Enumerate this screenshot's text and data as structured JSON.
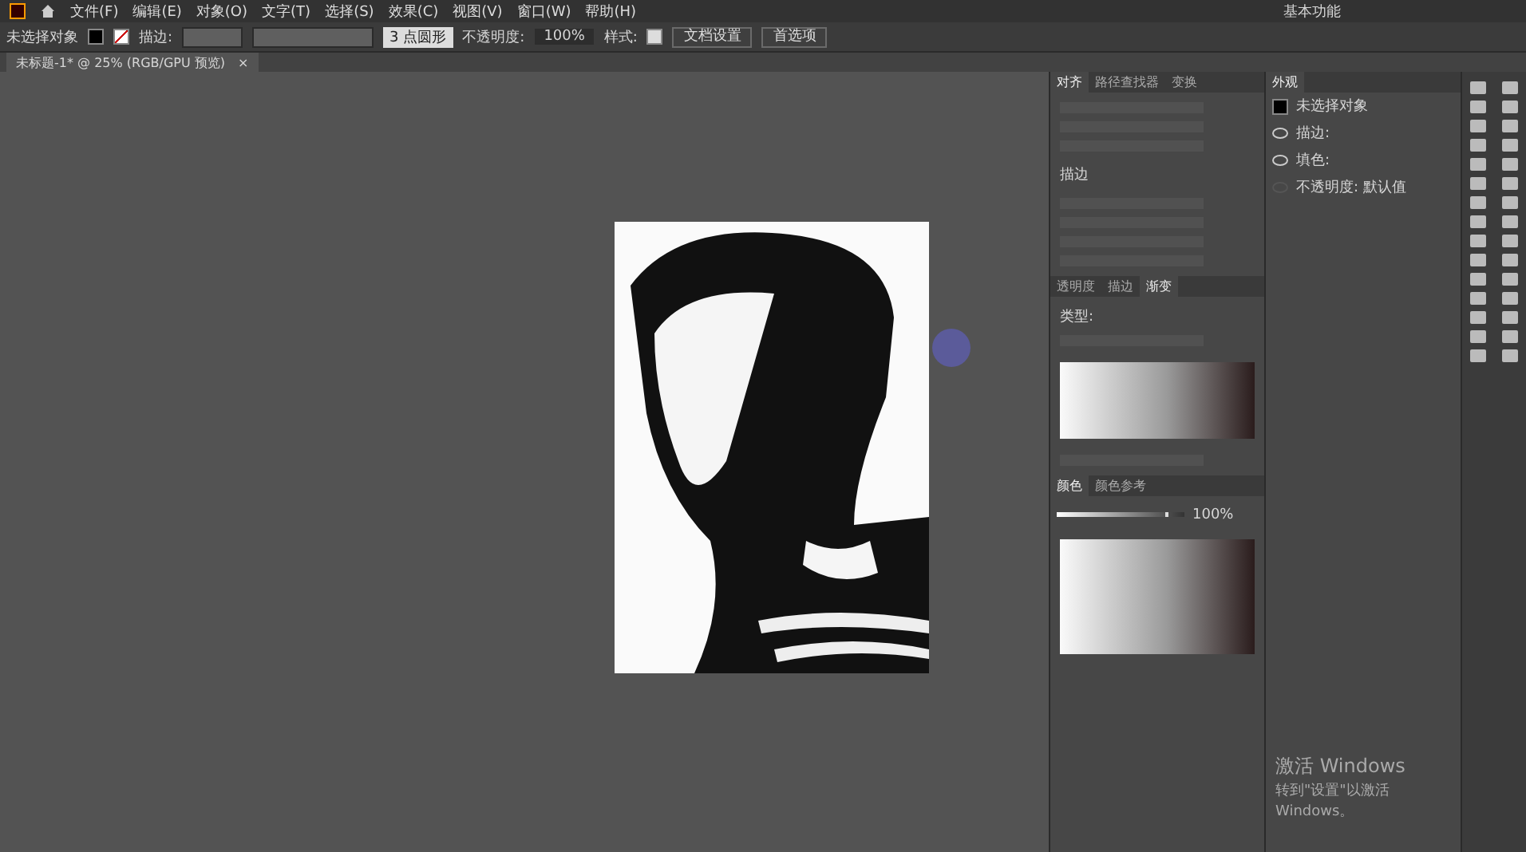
{
  "menu": {
    "items": [
      "文件(F)",
      "编辑(E)",
      "对象(O)",
      "文字(T)",
      "选择(S)",
      "效果(C)",
      "视图(V)",
      "窗口(W)",
      "帮助(H)"
    ],
    "workspace": "基本功能"
  },
  "control_bar": {
    "selection": "未选择对象",
    "stroke_label": "描边:",
    "brush": "3 点圆形",
    "opacity_label": "不透明度:",
    "opacity": "100%",
    "style_label": "样式:",
    "buttons": [
      "文档设置",
      "首选项"
    ]
  },
  "doc_tab": {
    "title": "未标题-1* @ 25% (RGB/GPU 预览)",
    "close": "×"
  },
  "align_panel": {
    "tabs": [
      {
        "label": "对齐",
        "selected": true
      },
      {
        "label": "路径查找器",
        "selected": false
      },
      {
        "label": "变换",
        "selected": false
      }
    ],
    "section": "描边"
  },
  "gradient_panel": {
    "tabs": [
      {
        "label": "透明度",
        "selected": false
      },
      {
        "label": "描边",
        "selected": false
      },
      {
        "label": "渐变",
        "selected": true
      }
    ],
    "type_label": "类型:"
  },
  "color_panel": {
    "tabs": [
      {
        "label": "颜色",
        "selected": true
      },
      {
        "label": "颜色参考",
        "selected": false
      }
    ],
    "level": 0.85,
    "reading": "100%"
  },
  "appearance_panel": {
    "tab": "外观",
    "title": "未选择对象",
    "rows": [
      {
        "label": "描边:",
        "visible": true
      },
      {
        "label": "填色:",
        "visible": true
      },
      {
        "label": "不透明度: 默认值",
        "visible": false
      }
    ]
  },
  "activation": {
    "title": "激活 Windows",
    "subtitle": "转到\"设置\"以激活 Windows。"
  }
}
